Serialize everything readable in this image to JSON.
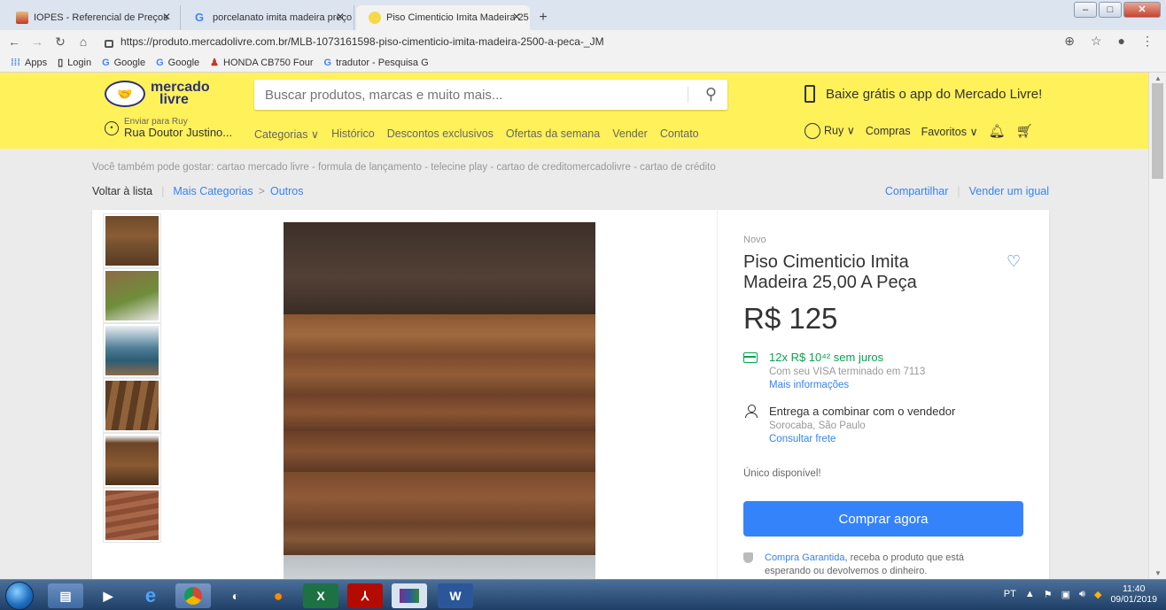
{
  "browser": {
    "tabs": [
      {
        "title": "IOPES - Referencial de Preços",
        "active": false
      },
      {
        "title": "porcelanato imita madeira preço",
        "active": false
      },
      {
        "title": "Piso Cimenticio Imita Madeira 25",
        "active": true
      }
    ],
    "url": "https://produto.mercadolivre.com.br/MLB-1073161598-piso-cimenticio-imita-madeira-2500-a-peca-_JM",
    "bookmarks": [
      "Apps",
      "Login",
      "Google",
      "Google",
      "HONDA CB750 Four",
      "tradutor - Pesquisa G"
    ]
  },
  "header": {
    "logo_line1": "mercado",
    "logo_line2": "livre",
    "search_placeholder": "Buscar produtos, marcas e muito mais...",
    "app_banner": "Baixe grátis o app do Mercado Livre!",
    "ship_label": "Enviar para Ruy",
    "ship_address": "Rua Doutor Justino...",
    "nav": [
      "Categorias ∨",
      "Histórico",
      "Descontos exclusivos",
      "Ofertas da semana",
      "Vender",
      "Contato"
    ],
    "user": "Ruy ∨",
    "purchases": "Compras",
    "favorites": "Favoritos ∨"
  },
  "page": {
    "suggestions": "Você também pode gostar: cartao mercado livre - formula de lançamento - telecine play - cartao de creditomercadolivre - cartao de crédito",
    "back": "Voltar à lista",
    "breadcrumb": [
      "Mais Categorias",
      "Outros"
    ],
    "share": "Compartilhar",
    "sell_same": "Vender um igual"
  },
  "product": {
    "condition": "Novo",
    "title": "Piso Cimenticio Imita Madeira 25,00 A Peça",
    "price": "R$ 125",
    "installments": "12x R$ 10⁴² sem juros",
    "installments_card": "Com seu VISA terminado em 7113",
    "more_info": "Mais informações",
    "delivery": "Entrega a combinar com o vendedor",
    "location": "Sorocaba, São Paulo",
    "shipping_link": "Consultar frete",
    "stock": "Único disponível!",
    "buy_button": "Comprar agora",
    "guarantee_link": "Compra Garantida",
    "guarantee_text": ", receba o produto que está esperando ou devolvemos o dinheiro."
  },
  "taskbar": {
    "lang": "PT",
    "time": "11:40",
    "date": "09/01/2019"
  },
  "colors": {
    "ml_yellow": "#fff159",
    "ml_blue": "#3483fa",
    "ml_green": "#00a650"
  }
}
